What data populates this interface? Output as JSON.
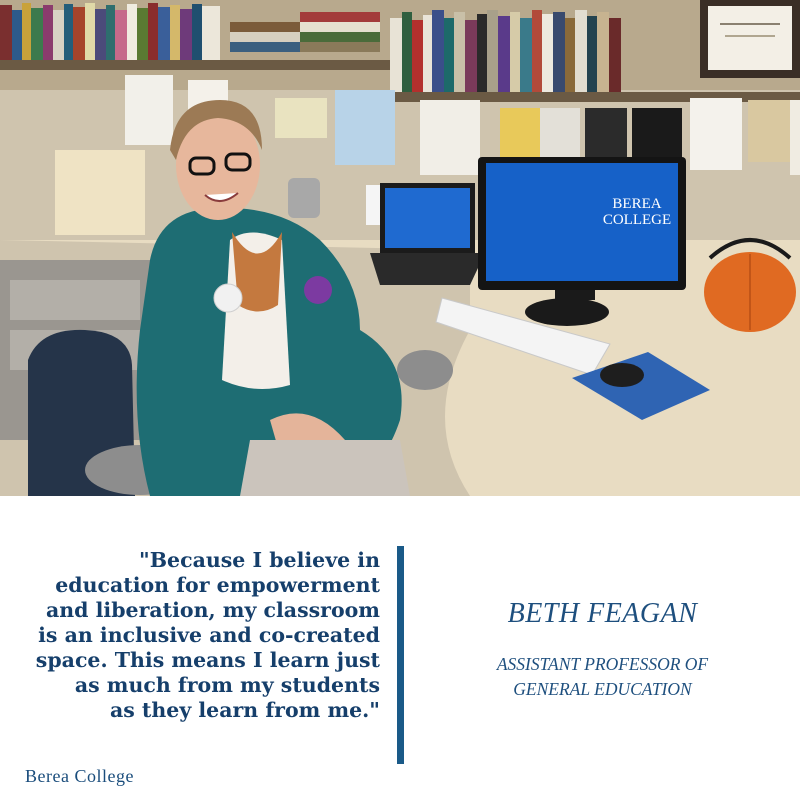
{
  "photo": {
    "description_icon": "photo-icon",
    "monitor_brand_text": "BEREA\nCOLLEGE",
    "colors": {
      "jacket": "#1e6d73",
      "screen": "#1661c8",
      "pumpkin": "#e06a22",
      "mousepad": "#2f64b3",
      "wall": "#cfc4ae",
      "desk": "#e8dcc2"
    }
  },
  "quote": {
    "text": "\"Because I believe in\neducation for empowerment\nand liberation, my classroom\nis an inclusive and co-created\nspace. This means I learn just\nas much from my students \nas they learn from me.\""
  },
  "person": {
    "name": "BETH FEAGAN",
    "title": "ASSISTANT PROFESSOR OF\nGENERAL EDUCATION"
  },
  "branding": {
    "wordmark": "Berea College",
    "color": "#1a4d7c"
  }
}
